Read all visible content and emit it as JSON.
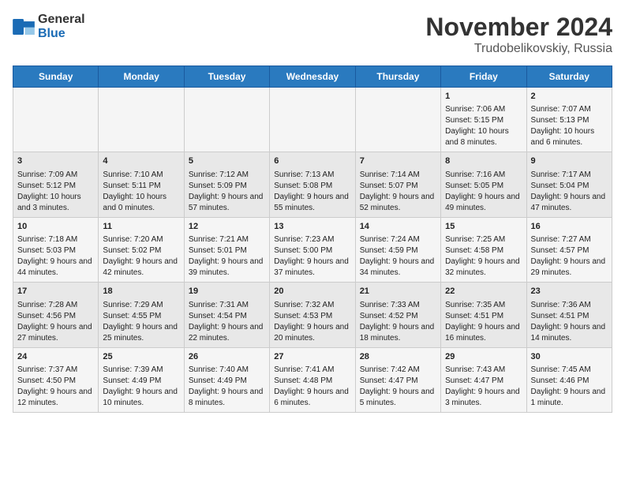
{
  "header": {
    "logo_general": "General",
    "logo_blue": "Blue",
    "title": "November 2024",
    "subtitle": "Trudobelikovskiy, Russia"
  },
  "weekdays": [
    "Sunday",
    "Monday",
    "Tuesday",
    "Wednesday",
    "Thursday",
    "Friday",
    "Saturday"
  ],
  "weeks": [
    [
      {
        "day": "",
        "info": ""
      },
      {
        "day": "",
        "info": ""
      },
      {
        "day": "",
        "info": ""
      },
      {
        "day": "",
        "info": ""
      },
      {
        "day": "",
        "info": ""
      },
      {
        "day": "1",
        "info": "Sunrise: 7:06 AM\nSunset: 5:15 PM\nDaylight: 10 hours and 8 minutes."
      },
      {
        "day": "2",
        "info": "Sunrise: 7:07 AM\nSunset: 5:13 PM\nDaylight: 10 hours and 6 minutes."
      }
    ],
    [
      {
        "day": "3",
        "info": "Sunrise: 7:09 AM\nSunset: 5:12 PM\nDaylight: 10 hours and 3 minutes."
      },
      {
        "day": "4",
        "info": "Sunrise: 7:10 AM\nSunset: 5:11 PM\nDaylight: 10 hours and 0 minutes."
      },
      {
        "day": "5",
        "info": "Sunrise: 7:12 AM\nSunset: 5:09 PM\nDaylight: 9 hours and 57 minutes."
      },
      {
        "day": "6",
        "info": "Sunrise: 7:13 AM\nSunset: 5:08 PM\nDaylight: 9 hours and 55 minutes."
      },
      {
        "day": "7",
        "info": "Sunrise: 7:14 AM\nSunset: 5:07 PM\nDaylight: 9 hours and 52 minutes."
      },
      {
        "day": "8",
        "info": "Sunrise: 7:16 AM\nSunset: 5:05 PM\nDaylight: 9 hours and 49 minutes."
      },
      {
        "day": "9",
        "info": "Sunrise: 7:17 AM\nSunset: 5:04 PM\nDaylight: 9 hours and 47 minutes."
      }
    ],
    [
      {
        "day": "10",
        "info": "Sunrise: 7:18 AM\nSunset: 5:03 PM\nDaylight: 9 hours and 44 minutes."
      },
      {
        "day": "11",
        "info": "Sunrise: 7:20 AM\nSunset: 5:02 PM\nDaylight: 9 hours and 42 minutes."
      },
      {
        "day": "12",
        "info": "Sunrise: 7:21 AM\nSunset: 5:01 PM\nDaylight: 9 hours and 39 minutes."
      },
      {
        "day": "13",
        "info": "Sunrise: 7:23 AM\nSunset: 5:00 PM\nDaylight: 9 hours and 37 minutes."
      },
      {
        "day": "14",
        "info": "Sunrise: 7:24 AM\nSunset: 4:59 PM\nDaylight: 9 hours and 34 minutes."
      },
      {
        "day": "15",
        "info": "Sunrise: 7:25 AM\nSunset: 4:58 PM\nDaylight: 9 hours and 32 minutes."
      },
      {
        "day": "16",
        "info": "Sunrise: 7:27 AM\nSunset: 4:57 PM\nDaylight: 9 hours and 29 minutes."
      }
    ],
    [
      {
        "day": "17",
        "info": "Sunrise: 7:28 AM\nSunset: 4:56 PM\nDaylight: 9 hours and 27 minutes."
      },
      {
        "day": "18",
        "info": "Sunrise: 7:29 AM\nSunset: 4:55 PM\nDaylight: 9 hours and 25 minutes."
      },
      {
        "day": "19",
        "info": "Sunrise: 7:31 AM\nSunset: 4:54 PM\nDaylight: 9 hours and 22 minutes."
      },
      {
        "day": "20",
        "info": "Sunrise: 7:32 AM\nSunset: 4:53 PM\nDaylight: 9 hours and 20 minutes."
      },
      {
        "day": "21",
        "info": "Sunrise: 7:33 AM\nSunset: 4:52 PM\nDaylight: 9 hours and 18 minutes."
      },
      {
        "day": "22",
        "info": "Sunrise: 7:35 AM\nSunset: 4:51 PM\nDaylight: 9 hours and 16 minutes."
      },
      {
        "day": "23",
        "info": "Sunrise: 7:36 AM\nSunset: 4:51 PM\nDaylight: 9 hours and 14 minutes."
      }
    ],
    [
      {
        "day": "24",
        "info": "Sunrise: 7:37 AM\nSunset: 4:50 PM\nDaylight: 9 hours and 12 minutes."
      },
      {
        "day": "25",
        "info": "Sunrise: 7:39 AM\nSunset: 4:49 PM\nDaylight: 9 hours and 10 minutes."
      },
      {
        "day": "26",
        "info": "Sunrise: 7:40 AM\nSunset: 4:49 PM\nDaylight: 9 hours and 8 minutes."
      },
      {
        "day": "27",
        "info": "Sunrise: 7:41 AM\nSunset: 4:48 PM\nDaylight: 9 hours and 6 minutes."
      },
      {
        "day": "28",
        "info": "Sunrise: 7:42 AM\nSunset: 4:47 PM\nDaylight: 9 hours and 5 minutes."
      },
      {
        "day": "29",
        "info": "Sunrise: 7:43 AM\nSunset: 4:47 PM\nDaylight: 9 hours and 3 minutes."
      },
      {
        "day": "30",
        "info": "Sunrise: 7:45 AM\nSunset: 4:46 PM\nDaylight: 9 hours and 1 minute."
      }
    ]
  ]
}
